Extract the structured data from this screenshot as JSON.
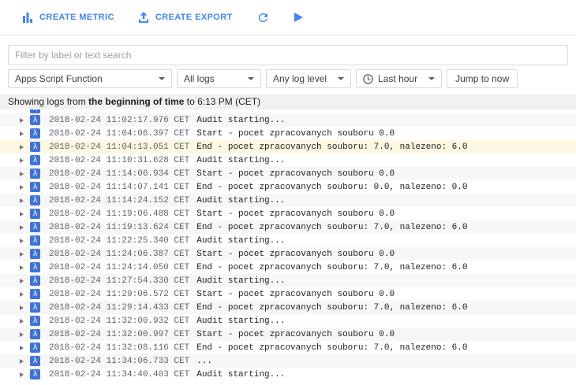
{
  "toolbar": {
    "create_metric_label": "CREATE METRIC",
    "create_export_label": "CREATE EXPORT",
    "accent_color": "#4285f4"
  },
  "filter_bar": {
    "placeholder": "Filter by label or text search"
  },
  "filter_row": {
    "resource_selector": "Apps Script Function",
    "logs_selector": "All logs",
    "log_level_selector": "Any log level",
    "time_range_selector": "Last hour",
    "jump_to_now_label": "Jump to now"
  },
  "status_bar": {
    "text_prefix": "Showing logs from",
    "text_bold": "the beginning of time",
    "text_suffix": "to 6:13 PM (CET)"
  },
  "log_list": {
    "lambda_glyph": "λ",
    "highlight_color": "#fcf8e1",
    "rows": [
      {
        "partial": true,
        "timestamp": "",
        "message": ""
      },
      {
        "timestamp": "2018-02-24 11:02:17.976 CET",
        "message": "Audit starting..."
      },
      {
        "timestamp": "2018-02-24 11:04:06.397 CET",
        "message": "Start - pocet zpracovanych souboru 0.0"
      },
      {
        "timestamp": "2018-02-24 11:04:13.051 CET",
        "message": "End - pocet zpracovanych souboru: 7.0, nalezeno: 6.0",
        "highlight": true
      },
      {
        "timestamp": "2018-02-24 11:10:31.628 CET",
        "message": "Audit starting..."
      },
      {
        "timestamp": "2018-02-24 11:14:06.934 CET",
        "message": "Start - pocet zpracovanych souboru 0.0"
      },
      {
        "timestamp": "2018-02-24 11:14:07.141 CET",
        "message": "End - pocet zpracovanych souboru: 0.0, nalezeno: 0.0"
      },
      {
        "timestamp": "2018-02-24 11:14:24.152 CET",
        "message": "Audit starting..."
      },
      {
        "timestamp": "2018-02-24 11:19:06.488 CET",
        "message": "Start - pocet zpracovanych souboru 0.0"
      },
      {
        "timestamp": "2018-02-24 11:19:13.624 CET",
        "message": "End - pocet zpracovanych souboru: 7.0, nalezeno: 6.0"
      },
      {
        "timestamp": "2018-02-24 11:22:25.340 CET",
        "message": "Audit starting..."
      },
      {
        "timestamp": "2018-02-24 11:24:06.387 CET",
        "message": "Start - pocet zpracovanych souboru 0.0"
      },
      {
        "timestamp": "2018-02-24 11:24:14.050 CET",
        "message": "End - pocet zpracovanych souboru: 7.0, nalezeno: 6.0"
      },
      {
        "timestamp": "2018-02-24 11:27:54.330 CET",
        "message": "Audit starting..."
      },
      {
        "timestamp": "2018-02-24 11:29:06.572 CET",
        "message": "Start - pocet zpracovanych souboru 0.0"
      },
      {
        "timestamp": "2018-02-24 11:29:14.433 CET",
        "message": "End - pocet zpracovanych souboru: 7.0, nalezeno: 6.0"
      },
      {
        "timestamp": "2018-02-24 11:32:00.932 CET",
        "message": "Audit starting..."
      },
      {
        "timestamp": "2018-02-24 11:32:00.997 CET",
        "message": "Start - pocet zpracovanych souboru 0.0"
      },
      {
        "timestamp": "2018-02-24 11:32:08.116 CET",
        "message": "End - pocet zpracovanych souboru: 7.0, nalezeno: 6.0"
      },
      {
        "timestamp": "2018-02-24 11:34:06.733 CET",
        "message": "..."
      },
      {
        "timestamp": "2018-02-24 11:34:40.403 CET",
        "message": "Audit starting..."
      }
    ]
  }
}
